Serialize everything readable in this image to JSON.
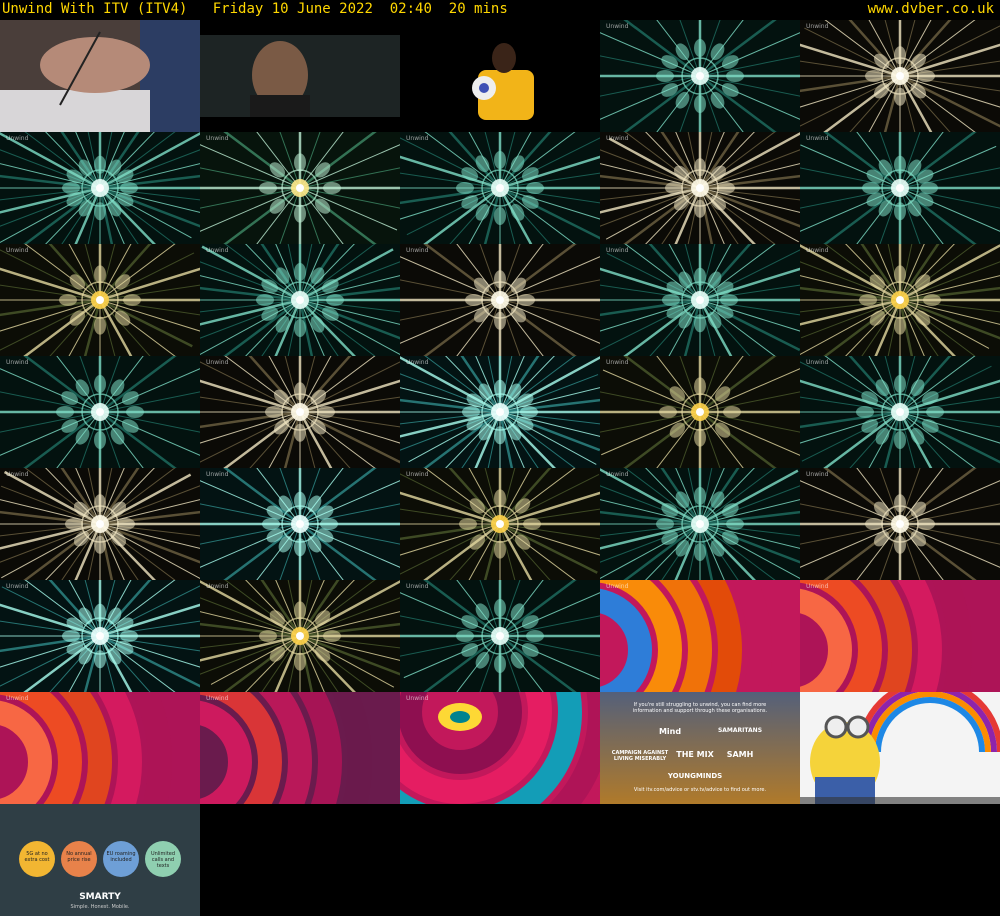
{
  "header": {
    "program": "Unwind With ITV (ITV4)",
    "date": "Friday 10 June 2022",
    "time": "02:40",
    "duration": "20 mins",
    "site": "www.dvber.co.uk"
  },
  "thumbnails": [
    {
      "kind": "photo-hand-writing"
    },
    {
      "kind": "photo-man-dark"
    },
    {
      "kind": "photo-goalkeeper"
    },
    {
      "kind": "kaleido",
      "palette": "teal"
    },
    {
      "kind": "kaleido",
      "palette": "cream"
    },
    {
      "kind": "kaleido",
      "palette": "teal"
    },
    {
      "kind": "kaleido",
      "palette": "green-gold"
    },
    {
      "kind": "kaleido",
      "palette": "teal"
    },
    {
      "kind": "kaleido",
      "palette": "cream"
    },
    {
      "kind": "kaleido",
      "palette": "teal"
    },
    {
      "kind": "kaleido",
      "palette": "gold"
    },
    {
      "kind": "kaleido",
      "palette": "teal"
    },
    {
      "kind": "kaleido",
      "palette": "cream"
    },
    {
      "kind": "kaleido",
      "palette": "teal"
    },
    {
      "kind": "kaleido",
      "palette": "gold"
    },
    {
      "kind": "kaleido",
      "palette": "teal"
    },
    {
      "kind": "kaleido",
      "palette": "cream"
    },
    {
      "kind": "kaleido",
      "palette": "cyan"
    },
    {
      "kind": "kaleido",
      "palette": "gold"
    },
    {
      "kind": "kaleido",
      "palette": "teal"
    },
    {
      "kind": "kaleido",
      "palette": "cream"
    },
    {
      "kind": "kaleido",
      "palette": "cyan"
    },
    {
      "kind": "kaleido",
      "palette": "gold"
    },
    {
      "kind": "kaleido",
      "palette": "teal"
    },
    {
      "kind": "kaleido",
      "palette": "cream"
    },
    {
      "kind": "kaleido",
      "palette": "cyan"
    },
    {
      "kind": "kaleido",
      "palette": "gold"
    },
    {
      "kind": "kaleido",
      "palette": "teal"
    },
    {
      "kind": "swirl",
      "palette": "orange"
    },
    {
      "kind": "swirl",
      "palette": "pink"
    },
    {
      "kind": "swirl",
      "palette": "pink"
    },
    {
      "kind": "swirl",
      "palette": "magenta"
    },
    {
      "kind": "swirl",
      "palette": "teal-pink"
    },
    {
      "kind": "charity-card"
    },
    {
      "kind": "minions-ad"
    },
    {
      "kind": "smarty-ad"
    }
  ],
  "watermark": "Unwind",
  "charity_card": {
    "intro": "If you're still struggling to unwind, you can find more information and support through these organisations.",
    "orgs": [
      "Mind",
      "SAMARITANS",
      "CAMPAIGN AGAINST LIVING MISERABLY",
      "THE MIX",
      "SAMH",
      "YOUNGMINDS"
    ],
    "footer": "Visit itv.com/advice or stv.tv/advice to find out more."
  },
  "smarty_ad": {
    "bubbles": [
      "5G at no extra cost",
      "No annual price rise",
      "EU roaming included",
      "Unlimited calls and texts"
    ],
    "brand": "SMARTY",
    "tagline": "Simple. Honest. Mobile."
  },
  "colors": {
    "header_text": "#ffd700",
    "background": "#000000"
  }
}
